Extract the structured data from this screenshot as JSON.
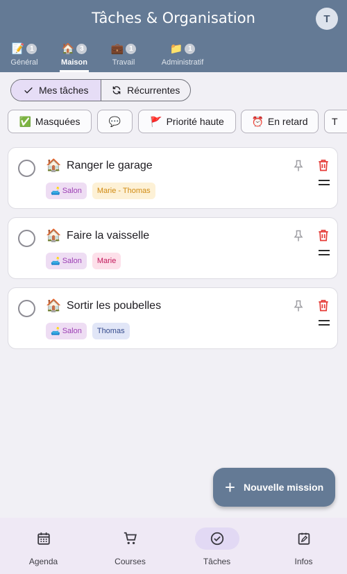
{
  "header": {
    "title": "Tâches & Organisation",
    "avatar_initial": "T",
    "tabs": [
      {
        "emoji": "📝",
        "count": "1",
        "label": "Général",
        "active": false
      },
      {
        "emoji": "🏠",
        "count": "3",
        "label": "Maison",
        "active": true
      },
      {
        "emoji": "💼",
        "count": "1",
        "label": "Travail",
        "active": false
      },
      {
        "emoji": "📁",
        "count": "1",
        "label": "Administratif",
        "active": false
      }
    ]
  },
  "segmented": {
    "mine": "Mes tâches",
    "recurring": "Récurrentes",
    "selected": "mine"
  },
  "filters": {
    "hidden_emoji": "✅",
    "hidden_label": "Masquées",
    "comment_emoji": "💬",
    "priority_emoji": "🚩",
    "priority_label": "Priorité haute",
    "late_emoji": "⏰",
    "late_label": "En retard",
    "cut_label": "T"
  },
  "tasks": [
    {
      "emoji": "🏠",
      "title": "Ranger le garage",
      "room_emoji": "🛋️",
      "room": "Salon",
      "people": "Marie - Thomas"
    },
    {
      "emoji": "🏠",
      "title": "Faire la vaisselle",
      "room_emoji": "🛋️",
      "room": "Salon",
      "people": "Marie"
    },
    {
      "emoji": "🏠",
      "title": "Sortir les poubelles",
      "room_emoji": "🛋️",
      "room": "Salon",
      "people": "Thomas"
    }
  ],
  "fab": {
    "icon": "+",
    "label": "Nouvelle mission"
  },
  "bottom_nav": [
    {
      "label": "Agenda",
      "icon": "calendar-icon"
    },
    {
      "label": "Courses",
      "icon": "cart-icon"
    },
    {
      "label": "Tâches",
      "icon": "check-circle-icon",
      "active": true
    },
    {
      "label": "Infos",
      "icon": "note-edit-icon"
    }
  ],
  "colors": {
    "header": "#647a95",
    "accent_active": "#e6ddf6",
    "delete": "#e53935"
  }
}
